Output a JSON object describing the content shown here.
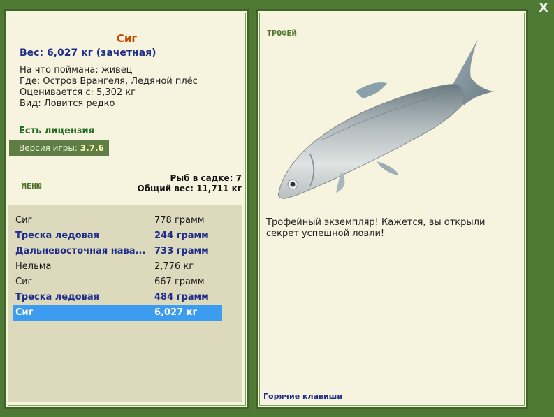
{
  "close_label": "X",
  "fish": {
    "name": "Сиг",
    "weight_line": "Вес: 6,027 кг (зачетная)",
    "caught_on": "На что поймана: живец",
    "location": "Где: Остров Врангеля, Ледяной плёс",
    "valued_from": "Оценивается с: 5,302 кг",
    "kind": "Вид: Ловится редко"
  },
  "license": "Есть лицензия",
  "version": {
    "label": "Версия игры:",
    "value": "3.7.6"
  },
  "menu_label": "МЕНЮ",
  "stats": {
    "fish_count": "Рыб в садке: 7",
    "total_weight": "Общий вес: 11,711 кг"
  },
  "catch_list": [
    {
      "name": "Сиг",
      "weight": "778 грамм",
      "style": "plain"
    },
    {
      "name": "Треска ледовая",
      "weight": "244 грамм",
      "style": "rare"
    },
    {
      "name": "Дальневосточная нава...",
      "weight": "733 грамм",
      "style": "rare"
    },
    {
      "name": "Нельма",
      "weight": "2,776 кг",
      "style": "plain"
    },
    {
      "name": "Сиг",
      "weight": "667 грамм",
      "style": "plain"
    },
    {
      "name": "Треска ледовая",
      "weight": "484 грамм",
      "style": "rare"
    },
    {
      "name": "Сиг",
      "weight": "6,027 кг",
      "style": "selected"
    }
  ],
  "trophy_label": "ТРОФЕЙ",
  "trophy_text": "Трофейный экземпляр! Кажется, вы открыли секрет успешной ловли!",
  "hotkeys_label": "Горячие клавиши",
  "colors": {
    "background": "#4f7a35",
    "panel": "#f6f3df",
    "selected_row": "#3c9cf0",
    "rare_text": "#1e2e8a",
    "title": "#c64a00"
  }
}
